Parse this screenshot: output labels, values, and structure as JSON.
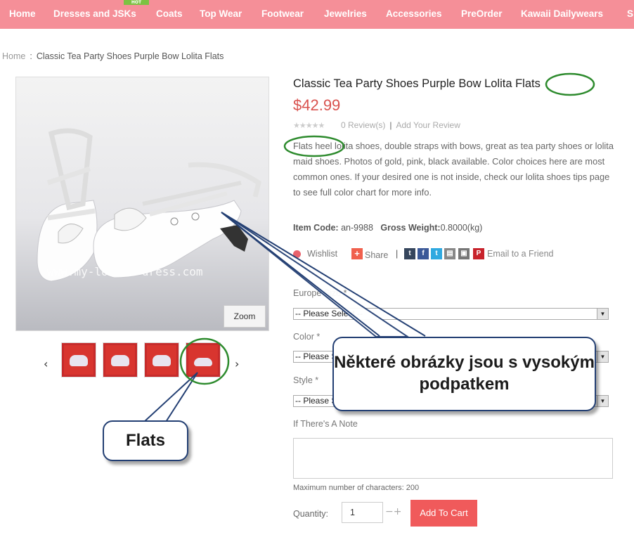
{
  "nav": {
    "items": [
      "Home",
      "Dresses and JSKs",
      "Coats",
      "Top Wear",
      "Footwear",
      "Jewelries",
      "Accessories",
      "PreOrder",
      "Kawaii Dailywears",
      "S"
    ],
    "hot_badge": "HOT"
  },
  "breadcrumb": {
    "home": "Home",
    "separator": ":",
    "current": "Classic Tea Party Shoes Purple Bow Lolita Flats"
  },
  "gallery": {
    "main_image_watermark": "www.my-lolita-dress.com",
    "zoom_label": "Zoom",
    "prev": "‹",
    "next": "›",
    "thumb_count": 4,
    "selected_thumb": 4
  },
  "product": {
    "title": "Classic Tea Party Shoes Purple Bow Lolita Flats",
    "price": "$42.99",
    "rating_stars": 0,
    "reviews_text": "0 Review(s)",
    "add_review": "Add Your Review",
    "description": "Flats heel lolita shoes, double straps with bows, great as tea party shoes or lolita maid shoes. Photos of gold, pink, black available. Color choices here are most common ones. If your desired one is not inside, check our lolita shoes tips page to see full color chart for more info.",
    "item_code_label": "Item Code:",
    "item_code": "an-9988",
    "weight_label": "Gross Weight:",
    "weight": "0.8000(kg)"
  },
  "share": {
    "wishlist": "Wishlist",
    "share": "Share",
    "icons": [
      "tumblr-icon",
      "facebook-icon",
      "twitter-icon",
      "print-icon",
      "save-icon",
      "pinterest-icon"
    ],
    "email": "Email to a Friend"
  },
  "options": {
    "europe_size_label": "Europe Size *",
    "color_label": "Color *",
    "style_label": "Style *",
    "select_placeholder": "-- Please Select --",
    "note_label": "If There's A Note",
    "max_chars": "Maximum number of characters: 200"
  },
  "cart": {
    "quantity_label": "Quantity:",
    "quantity": "1",
    "minus": "−",
    "plus": "+",
    "add_to_cart": "Add To Cart"
  },
  "annotations": {
    "heels_callout": "Některé obrázky jsou s vysokým podpatkem",
    "flats_callout": "Flats",
    "highlight_color": "#2e8b2e",
    "callout_border": "#233f73"
  },
  "colors": {
    "nav_bg": "#f58f98",
    "price": "#d9534f",
    "cart_button": "#f05a5b"
  }
}
